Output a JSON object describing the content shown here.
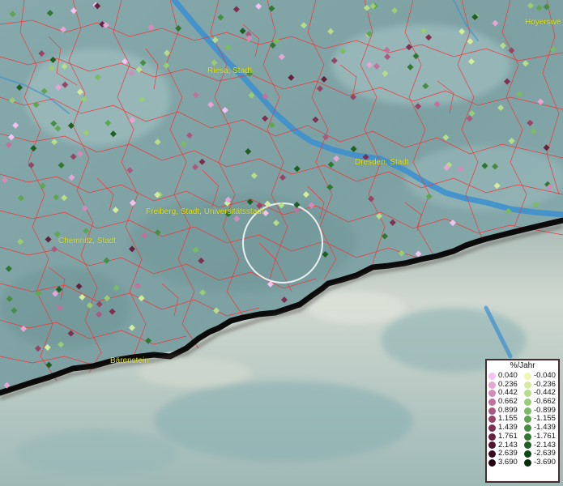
{
  "map": {
    "places": [
      {
        "name": "Riesa, Stadt"
      },
      {
        "name": "Hoyerswe"
      },
      {
        "name": "Dresden, Stadt"
      },
      {
        "name": "Freiberg, Stadt, Universitätsstadt"
      },
      {
        "name": "Chemnitz, Stadt"
      },
      {
        "name": "Bärenstein"
      }
    ],
    "colors": {
      "boundary": "#ff2a2a",
      "river": "#3a8fd0",
      "border_line": "#0a0a0a",
      "place_label": "#e8e80a",
      "selection_circle": "#ffffff"
    }
  },
  "legend": {
    "title": "%/Jahr",
    "positive": [
      {
        "label": "0.040",
        "color": "#f4c2f0"
      },
      {
        "label": "0.236",
        "color": "#e7a5d6"
      },
      {
        "label": "0.442",
        "color": "#d68ab9"
      },
      {
        "label": "0.662",
        "color": "#c3709c"
      },
      {
        "label": "0.899",
        "color": "#ad587f"
      },
      {
        "label": "1.155",
        "color": "#974467"
      },
      {
        "label": "1.439",
        "color": "#7f3051"
      },
      {
        "label": "1.761",
        "color": "#67203d"
      },
      {
        "label": "2.143",
        "color": "#50142c"
      },
      {
        "label": "2.639",
        "color": "#3a0a1d"
      },
      {
        "label": "3.690",
        "color": "#230410"
      }
    ],
    "negative": [
      {
        "label": "-0.040",
        "color": "#eef8b0"
      },
      {
        "label": "-0.236",
        "color": "#d3ed9c"
      },
      {
        "label": "-0.442",
        "color": "#b6de88"
      },
      {
        "label": "-0.662",
        "color": "#98cd74"
      },
      {
        "label": "-0.899",
        "color": "#7bbb62"
      },
      {
        "label": "-1.155",
        "color": "#5fa650"
      },
      {
        "label": "-1.439",
        "color": "#468f40"
      },
      {
        "label": "-1.761",
        "color": "#307730"
      },
      {
        "label": "-2.143",
        "color": "#1e5f22"
      },
      {
        "label": "-2.639",
        "color": "#0f4615"
      },
      {
        "label": "-3.690",
        "color": "#052d0a"
      }
    ]
  }
}
